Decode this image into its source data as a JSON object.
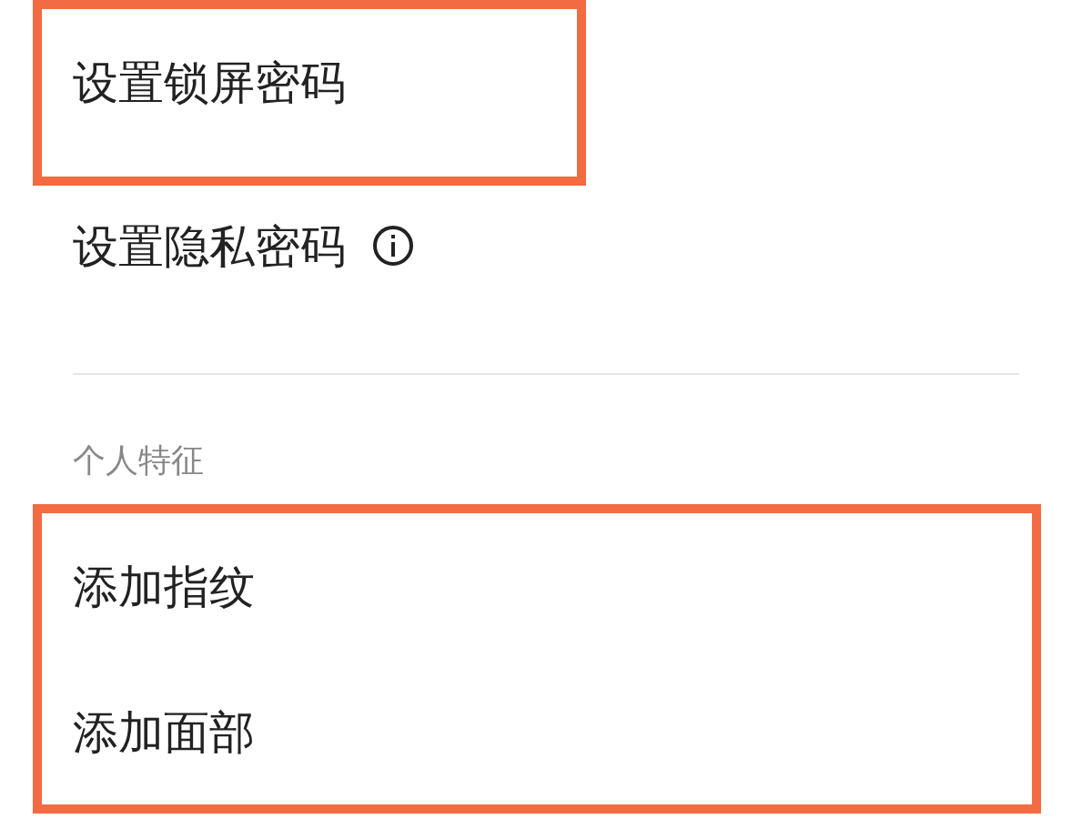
{
  "blocks": [
    {
      "kind": "group",
      "highlighted": true,
      "items": [
        {
          "label": "设置锁屏密码",
          "info": false
        }
      ]
    },
    {
      "kind": "group",
      "highlighted": false,
      "items": [
        {
          "label": "设置隐私密码",
          "info": true
        }
      ]
    },
    {
      "kind": "divider"
    },
    {
      "kind": "header",
      "label": "个人特征"
    },
    {
      "kind": "group",
      "highlighted": true,
      "items": [
        {
          "label": "添加指纹",
          "info": false
        },
        {
          "label": "添加面部",
          "info": false
        }
      ]
    }
  ]
}
